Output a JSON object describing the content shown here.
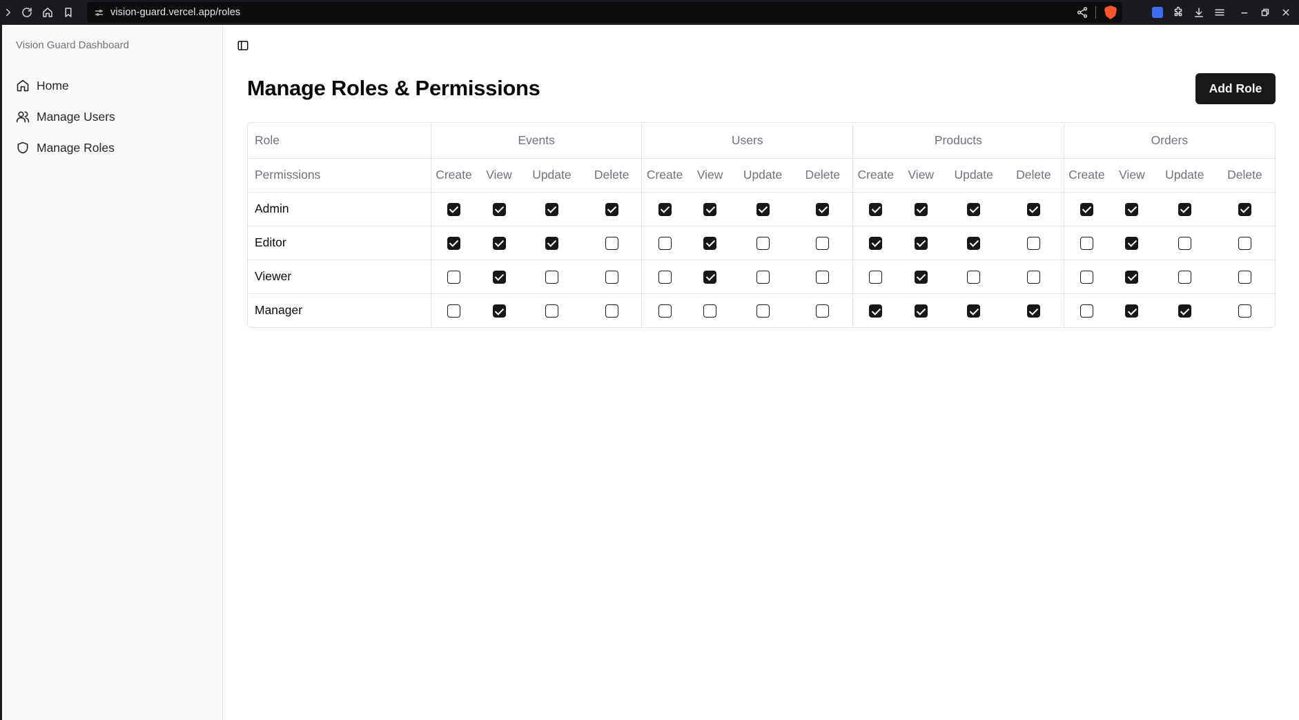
{
  "browser": {
    "url": "vision-guard.vercel.app/roles"
  },
  "sidebar": {
    "group_label": "Vision Guard Dashboard",
    "items": [
      {
        "label": "Home",
        "icon": "home-icon"
      },
      {
        "label": "Manage Users",
        "icon": "users-icon"
      },
      {
        "label": "Manage Roles",
        "icon": "shield-icon"
      }
    ]
  },
  "main": {
    "title": "Manage Roles & Permissions",
    "add_button": "Add Role"
  },
  "table": {
    "role_header": "Role",
    "permissions_header": "Permissions",
    "groups": [
      "Events",
      "Users",
      "Products",
      "Orders"
    ],
    "actions": [
      "Create",
      "View",
      "Update",
      "Delete"
    ],
    "rows": [
      {
        "role": "Admin",
        "perms": [
          1,
          1,
          1,
          1,
          1,
          1,
          1,
          1,
          1,
          1,
          1,
          1,
          1,
          1,
          1,
          1
        ]
      },
      {
        "role": "Editor",
        "perms": [
          1,
          1,
          1,
          0,
          0,
          1,
          0,
          0,
          1,
          1,
          1,
          0,
          0,
          1,
          0,
          0
        ]
      },
      {
        "role": "Viewer",
        "perms": [
          0,
          1,
          0,
          0,
          0,
          1,
          0,
          0,
          0,
          1,
          0,
          0,
          0,
          1,
          0,
          0
        ]
      },
      {
        "role": "Manager",
        "perms": [
          0,
          1,
          0,
          0,
          0,
          0,
          0,
          0,
          1,
          1,
          1,
          1,
          0,
          1,
          1,
          0
        ]
      }
    ]
  },
  "colors": {
    "primary": "#18181b",
    "muted_text": "#71717a",
    "border": "#e4e4e7",
    "sidebar_bg": "#fafafa",
    "chrome_bg": "#1b1b1f"
  }
}
